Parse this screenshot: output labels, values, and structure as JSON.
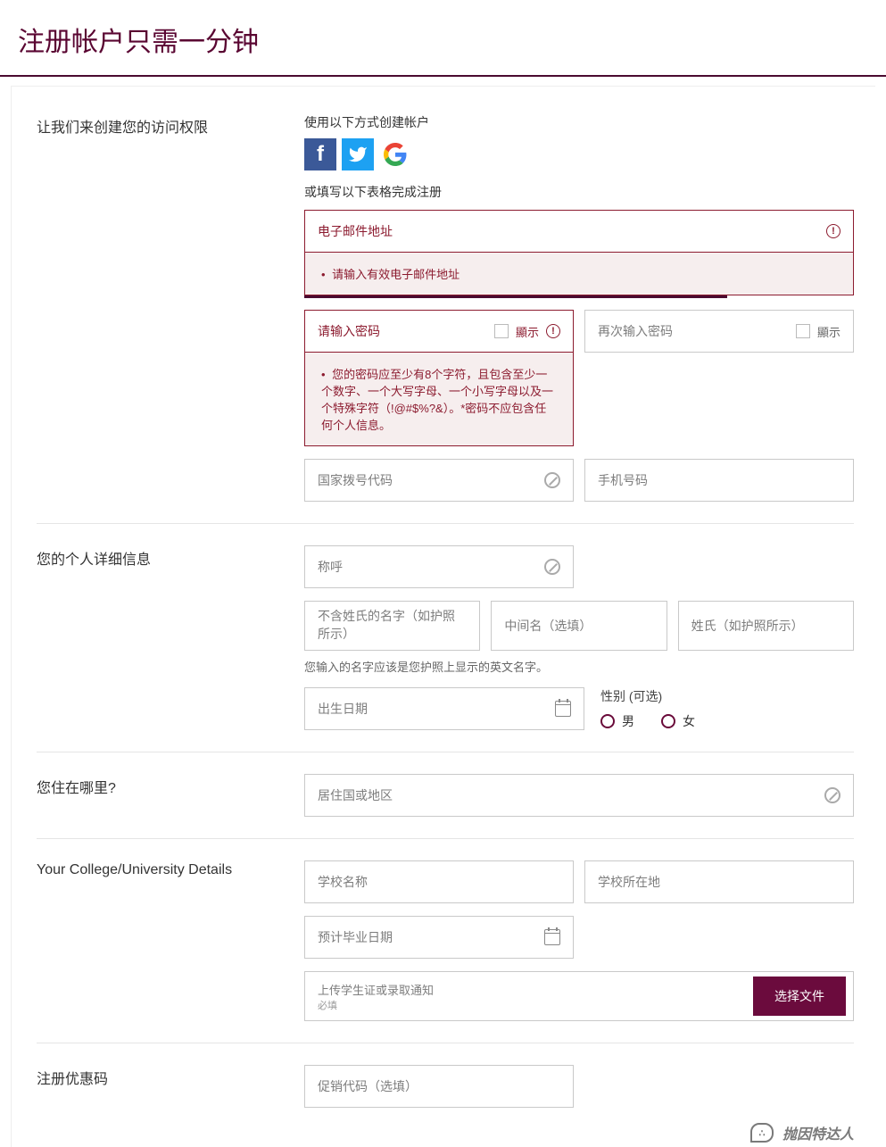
{
  "title": "注册帐户只需一分钟",
  "access": {
    "label": "让我们来创建您的访问权限",
    "create_with": "使用以下方式创建帐户",
    "or_fill": "或填写以下表格完成注册",
    "email_placeholder": "电子邮件地址",
    "email_error": "请输入有效电子邮件地址",
    "password_placeholder": "请输入密码",
    "show_label": "顯示",
    "password_error": "您的密码应至少有8个字符，且包含至少一个数字、一个大写字母、一个小写字母以及一个特殊字符（!@#$%?&）。*密码不应包含任何个人信息。",
    "confirm_placeholder": "再次输入密码",
    "dial_placeholder": "国家拨号代码",
    "mobile_placeholder": "手机号码"
  },
  "personal": {
    "label": "您的个人详细信息",
    "title_placeholder": "称呼",
    "first_placeholder": "不含姓氏的名字（如护照所示）",
    "middle_placeholder": "中间名（选填）",
    "last_placeholder": "姓氏（如护照所示）",
    "name_hint": "您输入的名字应该是您护照上显示的英文名字。",
    "dob_placeholder": "出生日期",
    "gender_label": "性别 (可选)",
    "male": "男",
    "female": "女"
  },
  "residence": {
    "label": "您住在哪里?",
    "country_placeholder": "居住国或地区"
  },
  "college": {
    "label": "Your College/University Details",
    "school_placeholder": "学校名称",
    "location_placeholder": "学校所在地",
    "grad_placeholder": "预计毕业日期",
    "upload_label": "上传学生证或录取通知",
    "required": "必填",
    "choose_file": "选择文件"
  },
  "promo": {
    "label": "注册优惠码",
    "code_placeholder": "促销代码（选填）"
  },
  "watermark": "抛因特达人"
}
